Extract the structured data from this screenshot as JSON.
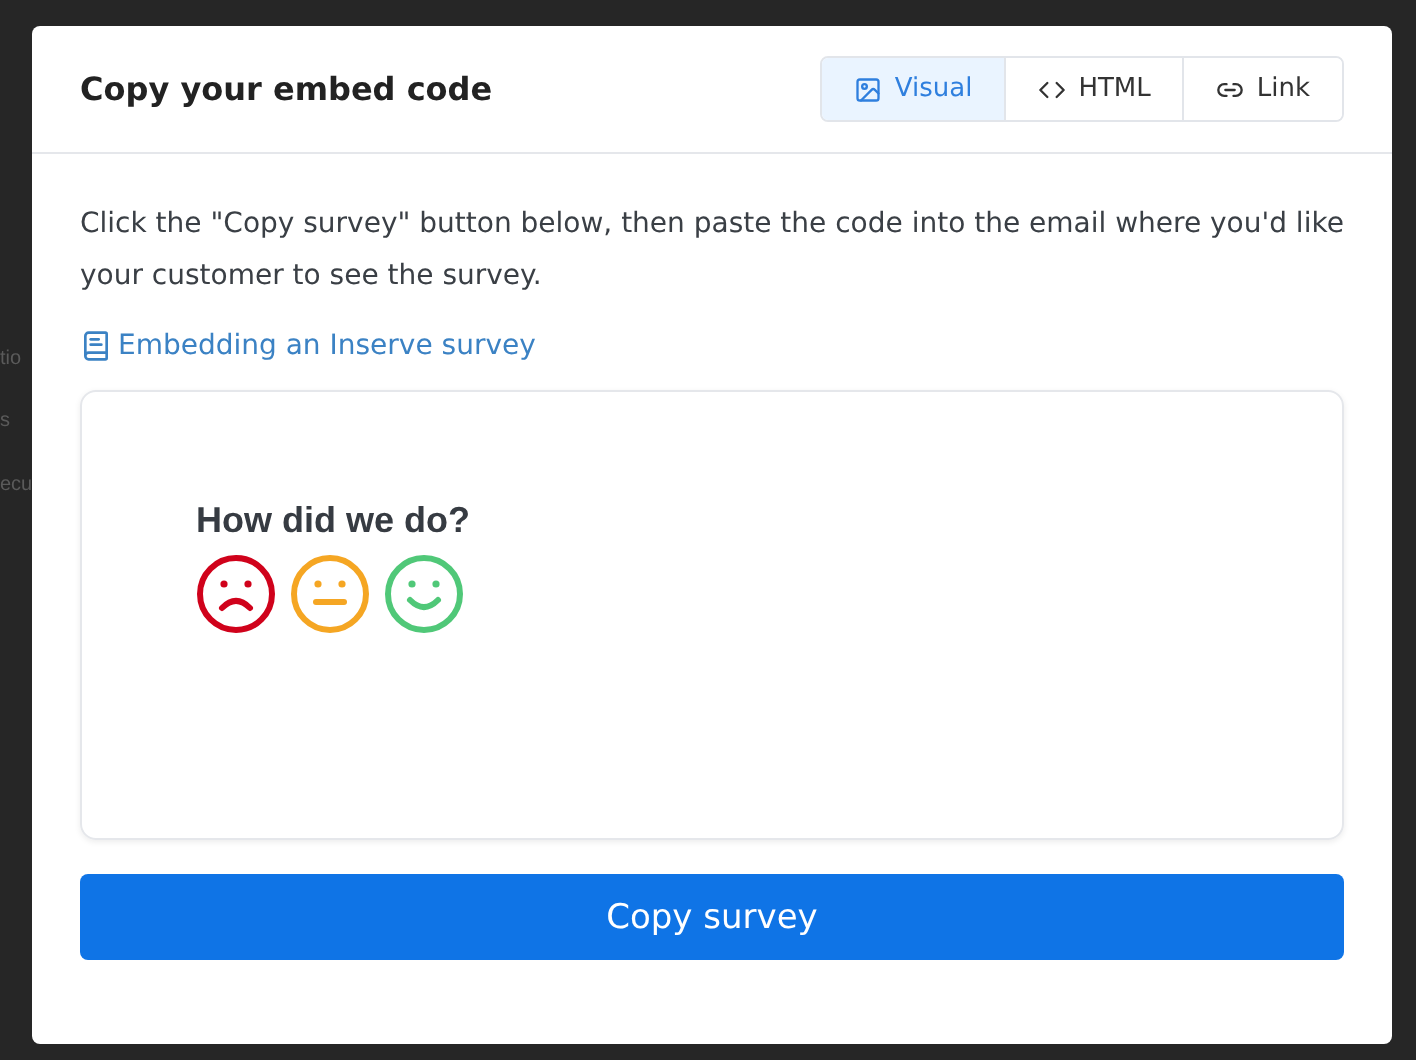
{
  "background_fragments": [
    "tio",
    "s",
    "ecu"
  ],
  "dialog": {
    "title": "Copy your embed code",
    "tabs": [
      {
        "label": "Visual",
        "selected": true
      },
      {
        "label": "HTML",
        "selected": false
      },
      {
        "label": "Link",
        "selected": false
      }
    ],
    "instructions": "Click the \"Copy survey\" button below, then paste the code into the email where you'd like your customer to see the survey.",
    "help_link": "Embedding an Inserve survey",
    "preview": {
      "question": "How did we do?",
      "faces": [
        {
          "color": "#d0021b"
        },
        {
          "color": "#f5a623"
        },
        {
          "color": "#50c878"
        }
      ]
    },
    "copy_button": "Copy survey"
  }
}
